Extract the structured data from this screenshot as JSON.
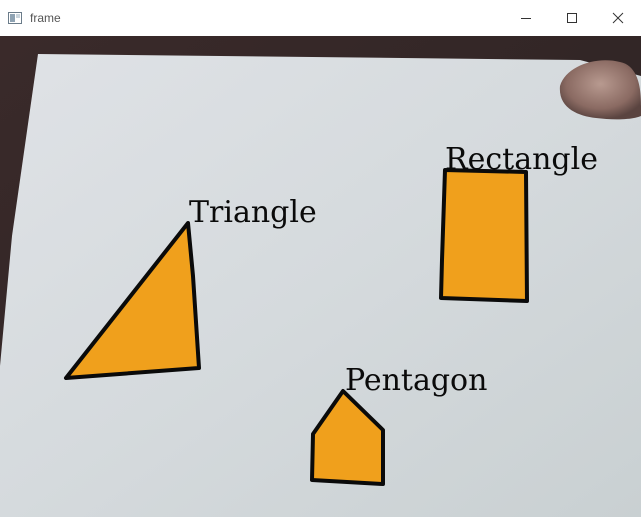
{
  "window": {
    "title": "frame",
    "controls": {
      "minimize": "minimize-icon",
      "maximize": "maximize-icon",
      "close": "close-icon"
    }
  },
  "frame": {
    "shapes": [
      {
        "name": "Triangle",
        "fill": "#f0a01c"
      },
      {
        "name": "Rectangle",
        "fill": "#f0a01c"
      },
      {
        "name": "Pentagon",
        "fill": "#f0a01c"
      }
    ],
    "colors": {
      "paper": "#d8dde0",
      "shape_fill": "#f0a01c",
      "contour": "#0a0a0a"
    }
  }
}
